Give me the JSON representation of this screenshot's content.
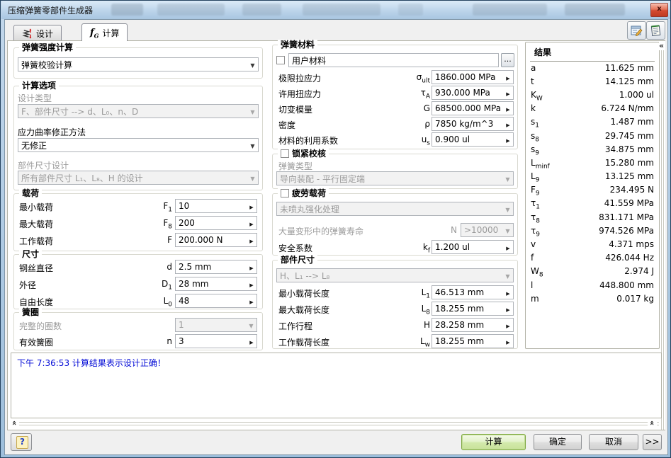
{
  "window": {
    "title": "压缩弹簧零部件生成器",
    "close_glyph": "x"
  },
  "tabs": {
    "design_label": "设计",
    "calc_label": "计算"
  },
  "left": {
    "strength": {
      "title": "弹簧强度计算",
      "method_value": "弹簧校验计算"
    },
    "options": {
      "title": "计算选项",
      "design_type_label": "设计类型",
      "design_type_value": "F、部件尺寸 --> d、L₀、n、D",
      "correction_label": "应力曲率修正方法",
      "correction_value": "无修正",
      "part_design_label": "部件尺寸设计",
      "part_design_value": "所有部件尺寸 L₁、L₈、H 的设计"
    },
    "loads": {
      "title": "载荷",
      "rows": [
        {
          "label": "最小载荷",
          "sym": "F",
          "sub": "1",
          "value": "10"
        },
        {
          "label": "最大载荷",
          "sym": "F",
          "sub": "8",
          "value": "200"
        },
        {
          "label": "工作载荷",
          "sym": "F",
          "sub": "",
          "value": "200.000 N"
        }
      ]
    },
    "dimensions": {
      "title": "尺寸",
      "rows": [
        {
          "label": "钢丝直径",
          "sym": "d",
          "sub": "",
          "value": "2.5 mm"
        },
        {
          "label": "外径",
          "sym": "D",
          "sub": "1",
          "value": "28 mm"
        },
        {
          "label": "自由长度",
          "sym": "L",
          "sub": "0",
          "value": "48"
        }
      ]
    },
    "coils": {
      "title": "簧圈",
      "full_coils_label": "完整的圈数",
      "full_coils_value": "1",
      "active_label": "有效簧圈",
      "active_sym": "n",
      "active_value": "3"
    }
  },
  "middle": {
    "material": {
      "title": "弹簧材料",
      "name_value": "用户材料",
      "browse_label": "...",
      "rows": [
        {
          "label": "极限拉应力",
          "sym": "σ",
          "sub": "ult",
          "value": "1860.000 MPa"
        },
        {
          "label": "许用扭应力",
          "sym": "τ",
          "sub": "A",
          "value": "930.000 MPa"
        },
        {
          "label": "切变模量",
          "sym": "G",
          "sub": "",
          "value": "68500.000 MPa"
        },
        {
          "label": "密度",
          "sym": "ρ",
          "sub": "",
          "value": "7850 kg/m^3"
        },
        {
          "label": "材料的利用系数",
          "sym": "u",
          "sub": "s",
          "value": "0.900 ul"
        }
      ]
    },
    "lock": {
      "title": "锁紧校核",
      "type_label": "弹簧类型",
      "type_value": "导向装配 - 平行固定端"
    },
    "fatigue": {
      "title": "疲劳载荷",
      "treatment_value": "未喷丸强化处理",
      "life_label": "大量变形中的弹簧寿命",
      "life_sym": "N",
      "life_value": ">10000",
      "safety_label": "安全系数",
      "safety_sym": "k",
      "safety_sub": "f",
      "safety_value": "1.200 ul"
    },
    "part_size": {
      "title": "部件尺寸",
      "mode_value": "H、L₁ --> L₈",
      "rows": [
        {
          "label": "最小载荷长度",
          "sym": "L",
          "sub": "1",
          "value": "46.513 mm"
        },
        {
          "label": "最大载荷长度",
          "sym": "L",
          "sub": "8",
          "value": "18.255 mm"
        },
        {
          "label": "工作行程",
          "sym": "H",
          "sub": "",
          "value": "28.258 mm"
        },
        {
          "label": "工作载荷长度",
          "sym": "L",
          "sub": "w",
          "value": "18.255 mm"
        }
      ]
    }
  },
  "results": {
    "title": "结果",
    "rows": [
      {
        "sym": "a",
        "sub": "",
        "value": "11.625 mm"
      },
      {
        "sym": "t",
        "sub": "",
        "value": "14.125 mm"
      },
      {
        "sym": "K",
        "sub": "W",
        "value": "1.000 ul"
      },
      {
        "sym": "k",
        "sub": "",
        "value": "6.724 N/mm"
      },
      {
        "sym": "s",
        "sub": "1",
        "value": "1.487 mm"
      },
      {
        "sym": "s",
        "sub": "8",
        "value": "29.745 mm"
      },
      {
        "sym": "s",
        "sub": "9",
        "value": "34.875 mm"
      },
      {
        "sym": "L",
        "sub": "minf",
        "value": "15.280 mm"
      },
      {
        "sym": "L",
        "sub": "9",
        "value": "13.125 mm"
      },
      {
        "sym": "F",
        "sub": "9",
        "value": "234.495 N"
      },
      {
        "sym": "τ",
        "sub": "1",
        "value": "41.559 MPa"
      },
      {
        "sym": "τ",
        "sub": "8",
        "value": "831.171 MPa"
      },
      {
        "sym": "τ",
        "sub": "9",
        "value": "974.526 MPa"
      },
      {
        "sym": "v",
        "sub": "",
        "value": "4.371 mps"
      },
      {
        "sym": "f",
        "sub": "",
        "value": "426.044 Hz"
      },
      {
        "sym": "W",
        "sub": "8",
        "value": "2.974 J"
      },
      {
        "sym": "l",
        "sub": "",
        "value": "448.800 mm"
      },
      {
        "sym": "m",
        "sub": "",
        "value": "0.017 kg"
      }
    ]
  },
  "message": {
    "text": "下午 7:36:53 计算结果表示设计正确！"
  },
  "footer": {
    "help": "?",
    "calculate": "计算",
    "ok": "确定",
    "cancel": "取消",
    "more": ">>"
  },
  "icons": {
    "collapse_left": "«",
    "collapse_up": "«"
  },
  "colors": {
    "accent_green": "#c8e29a",
    "message_blue": "#0008d6",
    "close_red": "#d34a31"
  }
}
